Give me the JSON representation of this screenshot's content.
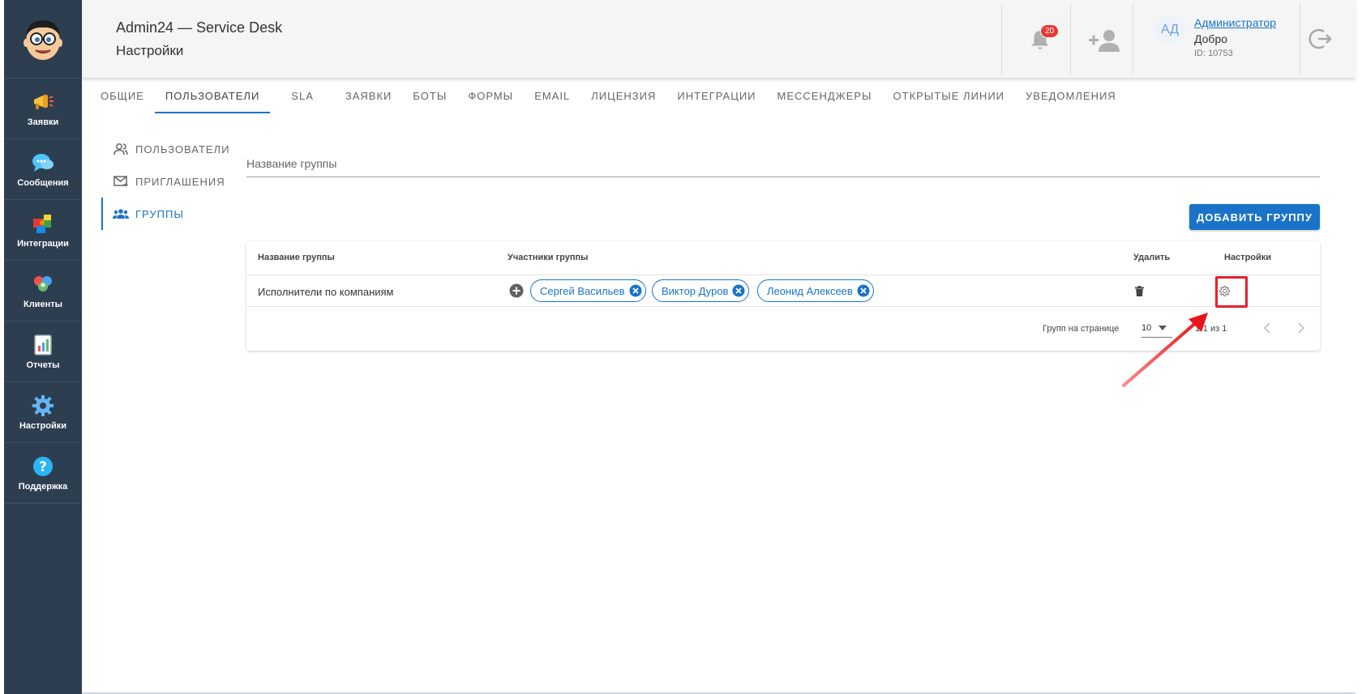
{
  "header": {
    "app_title": "Admin24 — Service Desk",
    "page_title": "Настройки",
    "notification_count": "20",
    "user": {
      "initials": "АД",
      "name": "Администратор",
      "greeting": "Добро",
      "id_label": "ID: 10753"
    }
  },
  "sidebar": {
    "items": [
      {
        "label": "Заявки",
        "icon": "megaphone-icon"
      },
      {
        "label": "Сообщения",
        "icon": "chat-bubble-icon"
      },
      {
        "label": "Интеграции",
        "icon": "puzzle-icon"
      },
      {
        "label": "Клиенты",
        "icon": "people-icon"
      },
      {
        "label": "Отчеты",
        "icon": "report-icon"
      },
      {
        "label": "Настройки",
        "icon": "gear-icon"
      },
      {
        "label": "Поддержка",
        "icon": "question-icon"
      }
    ]
  },
  "tabs": [
    {
      "label": "ОБЩИЕ"
    },
    {
      "label": "ПОЛЬЗОВАТЕЛИ",
      "active": true
    },
    {
      "label": "SLA"
    },
    {
      "label": "ЗАЯВКИ"
    },
    {
      "label": "БОТЫ"
    },
    {
      "label": "ФОРМЫ"
    },
    {
      "label": "EMAIL"
    },
    {
      "label": "ЛИЦЕНЗИЯ"
    },
    {
      "label": "ИНТЕГРАЦИИ"
    },
    {
      "label": "МЕССЕНДЖЕРЫ"
    },
    {
      "label": "ОТКРЫТЫЕ ЛИНИИ"
    },
    {
      "label": "УВЕДОМЛЕНИЯ"
    }
  ],
  "subnav": [
    {
      "label": "ПОЛЬЗОВАТЕЛИ"
    },
    {
      "label": "ПРИГЛАШЕНИЯ"
    },
    {
      "label": "ГРУППЫ",
      "active": true
    }
  ],
  "group_form": {
    "placeholder": "Название группы",
    "value": "",
    "add_button": "ДОБАВИТЬ ГРУППУ"
  },
  "table": {
    "headers": [
      "Название группы",
      "Участники группы",
      "Удалить",
      "Настройки"
    ],
    "rows": [
      {
        "name": "Исполнители по компаниям",
        "members": [
          "Сергей Васильев",
          "Виктор Дуров",
          "Леонид Алексеев"
        ]
      }
    ],
    "pagination": {
      "label": "Групп на странице",
      "per_page": "10",
      "range": "1-1 из 1"
    }
  },
  "colors": {
    "sidebar": "#2d3e50",
    "accent": "#1a73c9",
    "highlight": "#e8202a",
    "badge": "#e53935"
  }
}
